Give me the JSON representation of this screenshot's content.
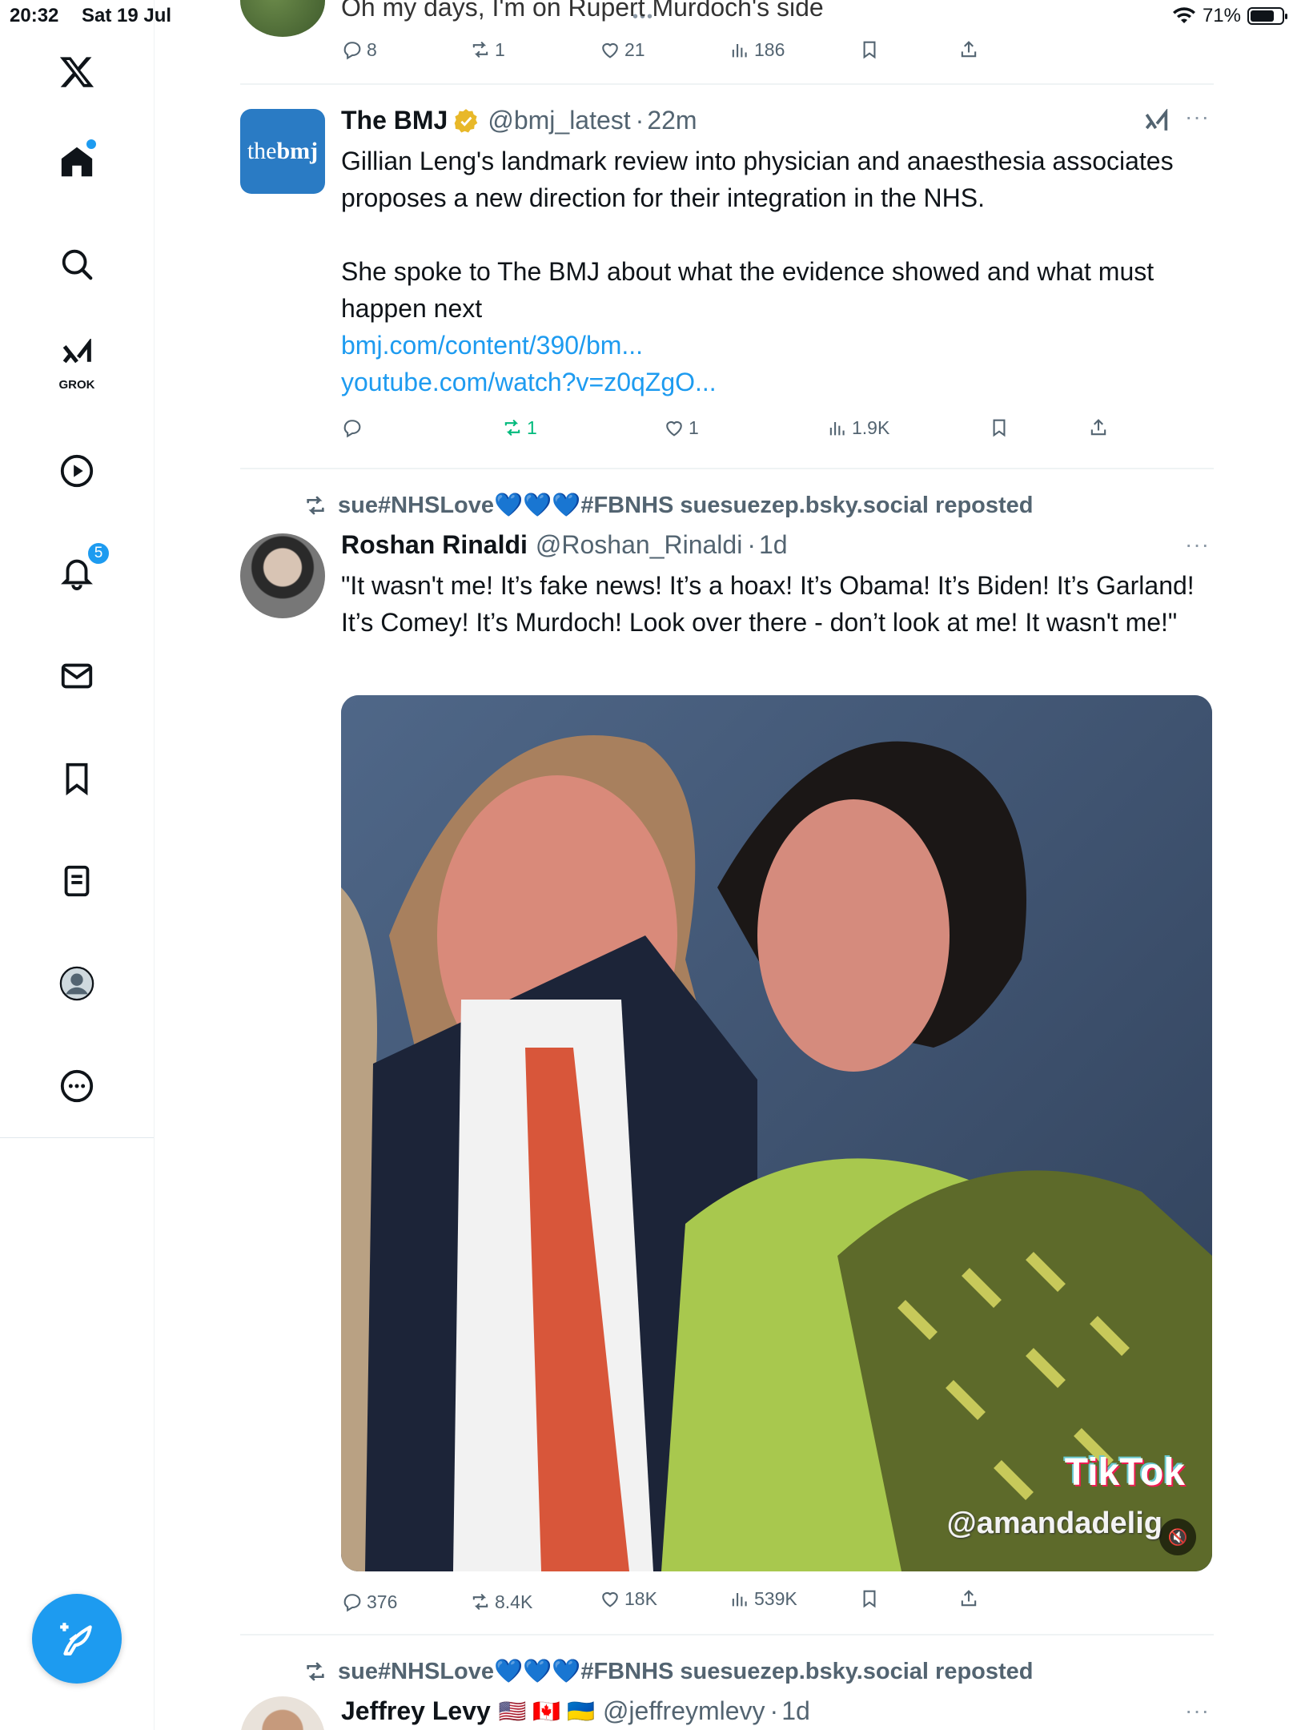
{
  "status_bar": {
    "time": "20:32",
    "date": "Sat 19 Jul",
    "battery": "71%"
  },
  "sidebar": {
    "items": [
      {
        "name": "x-logo-icon"
      },
      {
        "name": "home-icon"
      },
      {
        "name": "search-icon"
      },
      {
        "name": "grok-icon",
        "label": "GROK"
      },
      {
        "name": "video-icon"
      },
      {
        "name": "notifications-icon",
        "badge": "5"
      },
      {
        "name": "messages-icon"
      },
      {
        "name": "bookmarks-icon"
      },
      {
        "name": "lists-icon"
      },
      {
        "name": "profile-icon"
      },
      {
        "name": "more-icon"
      }
    ]
  },
  "tweets": [
    {
      "text": "Oh my days, I'm on Rupert Murdoch's side",
      "stats": {
        "replies": "8",
        "reposts": "1",
        "likes": "21",
        "views": "186"
      }
    },
    {
      "name": "The BMJ",
      "handle": "@bmj_latest",
      "time": "22m",
      "avatar_text": "the",
      "avatar_text_bold": "bmj",
      "text_p1": "Gillian Leng's landmark review into physician and anaesthesia associates proposes a new direction for their integration in the NHS.",
      "text_p2": "She spoke to The BMJ about what the evidence showed and what must happen next",
      "link1": "bmj.com/content/390/bm...",
      "link2": "youtube.com/watch?v=z0qZgO...",
      "stats": {
        "replies": "",
        "reposts": "1",
        "likes": "1",
        "views": "1.9K"
      }
    },
    {
      "repost_label": "sue#NHSLove💙💙💙#FBNHS suesuezep.bsky.social reposted",
      "name": "Roshan Rinaldi",
      "handle": "@Roshan_Rinaldi",
      "time": "1d",
      "text": "\"It wasn't me! It’s fake news! It’s a hoax! It’s Obama! It’s Biden! It’s Garland! It’s Comey! It’s Murdoch! Look over there - don’t look at me! It wasn't me!\"",
      "media": {
        "watermark": "TikTok",
        "watermark_handle": "@amandadelig"
      },
      "stats": {
        "replies": "376",
        "reposts": "8.4K",
        "likes": "18K",
        "views": "539K"
      }
    },
    {
      "repost_label": "sue#NHSLove💙💙💙#FBNHS suesuezep.bsky.social reposted",
      "name": "Jeffrey Levy",
      "flags": "🇺🇸 🇨🇦 🇺🇦",
      "handle": "@jeffreymlevy",
      "time": "1d"
    }
  ],
  "colors": {
    "accent": "#1d9bf0",
    "repost_green": "#00ba7c",
    "muted": "#536471",
    "bmj_blue": "#2a7bc4"
  }
}
